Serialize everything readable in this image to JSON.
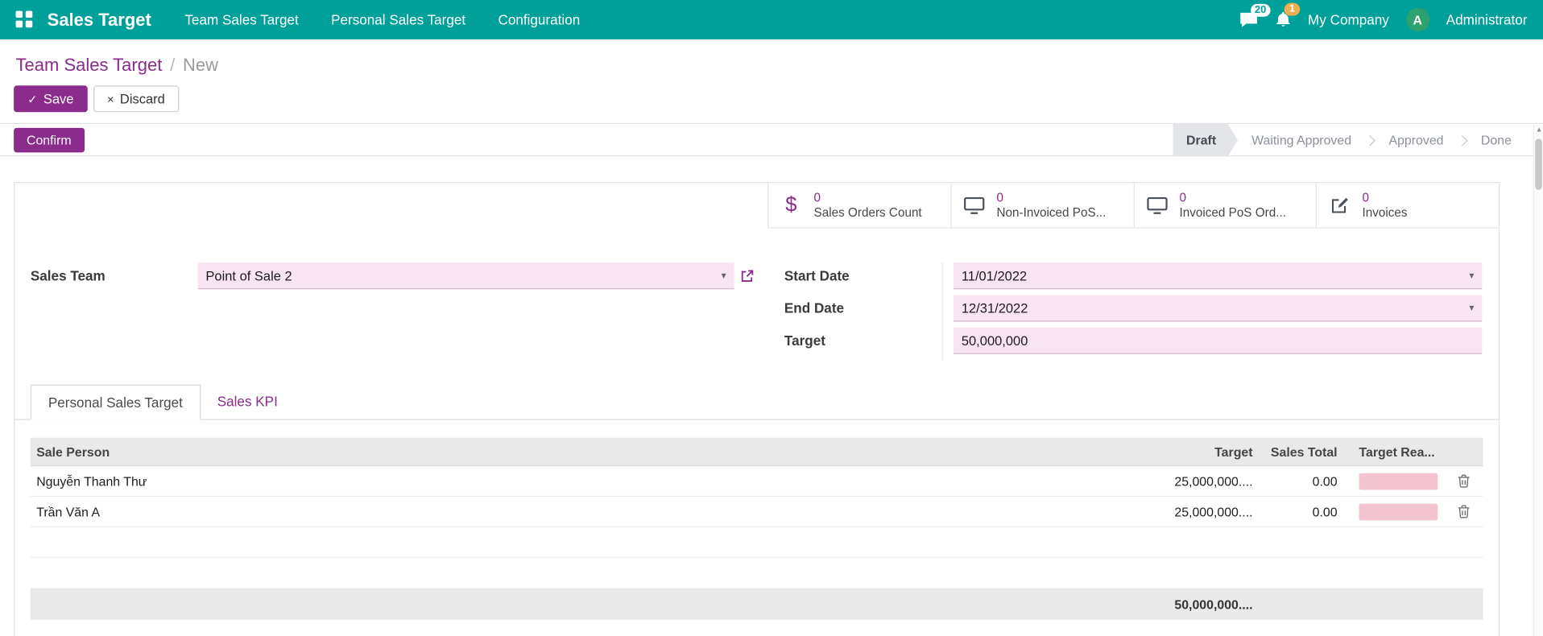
{
  "colors": {
    "teal": "#00A09A",
    "primary": "#8B2B8B",
    "field-bg": "#F8E4F3",
    "progress": "#F2C4CF",
    "avatar-green": "#2EA26E",
    "badge-amber": "#F0AD4E"
  },
  "icons": {
    "caret": "▾",
    "scroll_up": "▲"
  },
  "nav": {
    "app_name": "Sales Target",
    "menu_team": "Team Sales Target",
    "menu_personal": "Personal Sales Target",
    "menu_config": "Configuration",
    "messages_badge": "20",
    "activities_badge": "1",
    "company": "My Company",
    "avatar_letter": "A",
    "user": "Administrator"
  },
  "breadcrumb": {
    "parent": "Team Sales Target",
    "separator": "/",
    "current": "New"
  },
  "actions": {
    "save_icon": "✓",
    "save": "Save",
    "discard_icon": "×",
    "discard": "Discard"
  },
  "header": {
    "confirm": "Confirm",
    "statusbar": {
      "draft": "Draft",
      "waiting": "Waiting Approved",
      "approved": "Approved",
      "done": "Done"
    }
  },
  "stats": [
    {
      "icon": "dollar-icon",
      "glyph": "$",
      "value": "0",
      "label": "Sales Orders Count"
    },
    {
      "icon": "monitor-icon",
      "value": "0",
      "label": "Non-Invoiced PoS..."
    },
    {
      "icon": "monitor-icon",
      "value": "0",
      "label": "Invoiced PoS Ord..."
    },
    {
      "icon": "edit-icon",
      "value": "0",
      "label": "Invoices"
    }
  ],
  "fields": {
    "sales_team": {
      "label": "Sales Team",
      "value": "Point of Sale 2"
    },
    "start_date": {
      "label": "Start Date",
      "value": "11/01/2022"
    },
    "end_date": {
      "label": "End Date",
      "value": "12/31/2022"
    },
    "target": {
      "label": "Target",
      "value": "50,000,000"
    }
  },
  "tabs": {
    "personal": "Personal Sales Target",
    "kpi": "Sales KPI"
  },
  "table": {
    "headers": {
      "person": "Sale Person",
      "target": "Target",
      "sales_total": "Sales Total",
      "reached": "Target Rea..."
    },
    "rows": [
      {
        "person": "Nguyễn Thanh Thư",
        "target": "25,000,000....",
        "sales_total": "0.00"
      },
      {
        "person": "Trần Văn A",
        "target": "25,000,000....",
        "sales_total": "0.00"
      }
    ],
    "total": "50,000,000...."
  }
}
